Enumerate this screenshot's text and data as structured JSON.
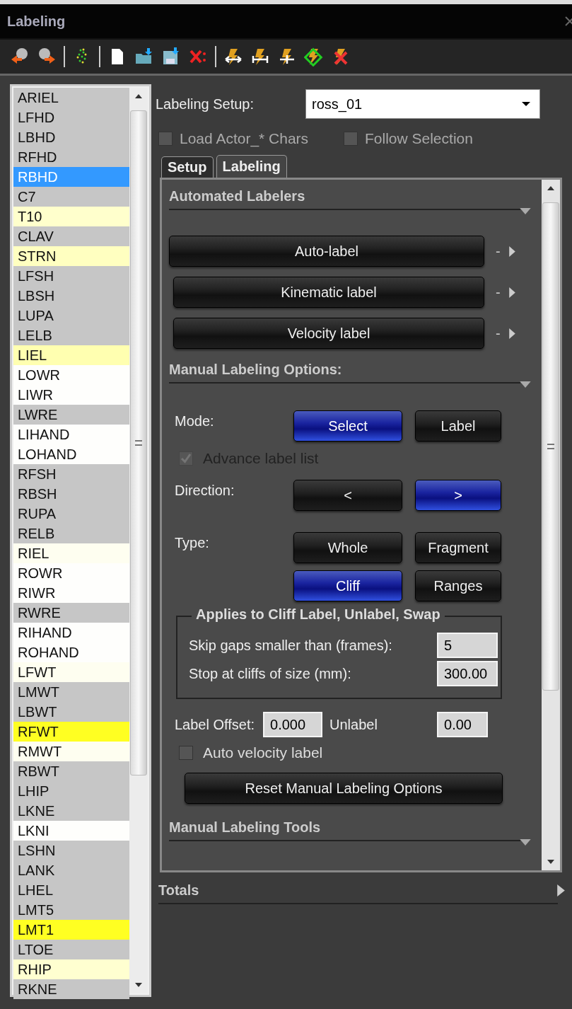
{
  "window": {
    "title": "Labeling"
  },
  "marker_list": {
    "items": [
      {
        "label": "ARIEL",
        "color": "#c6c6c6",
        "selected": false
      },
      {
        "label": "LFHD",
        "color": "#c6c6c6",
        "selected": false
      },
      {
        "label": "LBHD",
        "color": "#c6c6c6",
        "selected": false
      },
      {
        "label": "RFHD",
        "color": "#c6c6c6",
        "selected": false
      },
      {
        "label": "RBHD",
        "color": "#3399ff",
        "selected": true
      },
      {
        "label": "C7",
        "color": "#c6c6c6",
        "selected": false
      },
      {
        "label": "T10",
        "color": "#ffffcc",
        "selected": false
      },
      {
        "label": "CLAV",
        "color": "#c6c6c6",
        "selected": false
      },
      {
        "label": "STRN",
        "color": "#ffffc0",
        "selected": false
      },
      {
        "label": "LFSH",
        "color": "#c6c6c6",
        "selected": false
      },
      {
        "label": "LBSH",
        "color": "#c6c6c6",
        "selected": false
      },
      {
        "label": "LUPA",
        "color": "#c6c6c6",
        "selected": false
      },
      {
        "label": "LELB",
        "color": "#c6c6c6",
        "selected": false
      },
      {
        "label": "LIEL",
        "color": "#ffffb0",
        "selected": false
      },
      {
        "label": "LOWR",
        "color": "#fefefc",
        "selected": false
      },
      {
        "label": "LIWR",
        "color": "#fefefc",
        "selected": false
      },
      {
        "label": "LWRE",
        "color": "#c6c6c6",
        "selected": false
      },
      {
        "label": "LIHAND",
        "color": "#fefefc",
        "selected": false
      },
      {
        "label": "LOHAND",
        "color": "#fefefc",
        "selected": false
      },
      {
        "label": "RFSH",
        "color": "#c6c6c6",
        "selected": false
      },
      {
        "label": "RBSH",
        "color": "#c6c6c6",
        "selected": false
      },
      {
        "label": "RUPA",
        "color": "#c6c6c6",
        "selected": false
      },
      {
        "label": "RELB",
        "color": "#c6c6c6",
        "selected": false
      },
      {
        "label": "RIEL",
        "color": "#fefef0",
        "selected": false
      },
      {
        "label": "ROWR",
        "color": "#fefefc",
        "selected": false
      },
      {
        "label": "RIWR",
        "color": "#fefefc",
        "selected": false
      },
      {
        "label": "RWRE",
        "color": "#c6c6c6",
        "selected": false
      },
      {
        "label": "RIHAND",
        "color": "#fefefc",
        "selected": false
      },
      {
        "label": "ROHAND",
        "color": "#fefefc",
        "selected": false
      },
      {
        "label": "LFWT",
        "color": "#fefef0",
        "selected": false
      },
      {
        "label": "LMWT",
        "color": "#c6c6c6",
        "selected": false
      },
      {
        "label": "LBWT",
        "color": "#c6c6c6",
        "selected": false
      },
      {
        "label": "RFWT",
        "color": "#ffff22",
        "selected": false
      },
      {
        "label": "RMWT",
        "color": "#fefef0",
        "selected": false
      },
      {
        "label": "RBWT",
        "color": "#c6c6c6",
        "selected": false
      },
      {
        "label": "LHIP",
        "color": "#c6c6c6",
        "selected": false
      },
      {
        "label": "LKNE",
        "color": "#c6c6c6",
        "selected": false
      },
      {
        "label": "LKNI",
        "color": "#fefefc",
        "selected": false
      },
      {
        "label": "LSHN",
        "color": "#c6c6c6",
        "selected": false
      },
      {
        "label": "LANK",
        "color": "#c6c6c6",
        "selected": false
      },
      {
        "label": "LHEL",
        "color": "#c6c6c6",
        "selected": false
      },
      {
        "label": "LMT5",
        "color": "#c6c6c6",
        "selected": false
      },
      {
        "label": "LMT1",
        "color": "#ffff22",
        "selected": false
      },
      {
        "label": "LTOE",
        "color": "#c6c6c6",
        "selected": false
      },
      {
        "label": "RHIP",
        "color": "#ffffd0",
        "selected": false
      },
      {
        "label": "RKNE",
        "color": "#c6c6c6",
        "selected": false
      }
    ]
  },
  "setup": {
    "label": "Labeling Setup:",
    "value": "ross_01"
  },
  "options": [
    {
      "label": "Load Actor_* Chars",
      "checked": false
    },
    {
      "label": "Follow Selection",
      "checked": false
    }
  ],
  "tabs": [
    {
      "label": "Setup",
      "selected": false
    },
    {
      "label": "Labeling",
      "selected": true
    }
  ],
  "automated": {
    "title": "Automated Labelers",
    "expanded": true,
    "buttons": [
      {
        "label": "Auto-label",
        "more": "-"
      },
      {
        "label": "Kinematic label",
        "more": "-"
      },
      {
        "label": "Velocity label",
        "more": "-"
      }
    ]
  },
  "manual_options": {
    "title": "Manual Labeling Options:",
    "expanded": true,
    "mode": {
      "label": "Mode:",
      "options": [
        {
          "label": "Select",
          "selected": true
        },
        {
          "label": "Label",
          "selected": false
        }
      ]
    },
    "advance": {
      "label": "Advance label list",
      "checked": true,
      "disabled": true
    },
    "direction": {
      "label": "Direction:",
      "options": [
        {
          "label": "<",
          "selected": false
        },
        {
          "label": ">",
          "selected": true
        }
      ]
    },
    "type": {
      "label": "Type:",
      "options": [
        {
          "label": "Whole",
          "selected": false
        },
        {
          "label": "Fragment",
          "selected": false
        },
        {
          "label": "Cliff",
          "selected": true
        },
        {
          "label": "Ranges",
          "selected": false
        }
      ]
    },
    "group": {
      "title": "Applies to Cliff Label, Unlabel, Swap",
      "fields": [
        {
          "label": "Skip gaps smaller than (frames):",
          "value": "5"
        },
        {
          "label": "Stop at cliffs of size (mm):",
          "value": "300.00"
        }
      ]
    },
    "label_offset": {
      "label": "Label Offset:",
      "value": "0.000"
    },
    "unlabel": {
      "label": "Unlabel",
      "value": "0.00"
    },
    "auto_velocity": {
      "label": "Auto velocity label",
      "checked": false
    },
    "reset_button": "Reset Manual Labeling Options"
  },
  "manual_tools": {
    "title": "Manual Labeling Tools",
    "expanded": true
  },
  "totals": {
    "title": "Totals",
    "expanded": false
  }
}
